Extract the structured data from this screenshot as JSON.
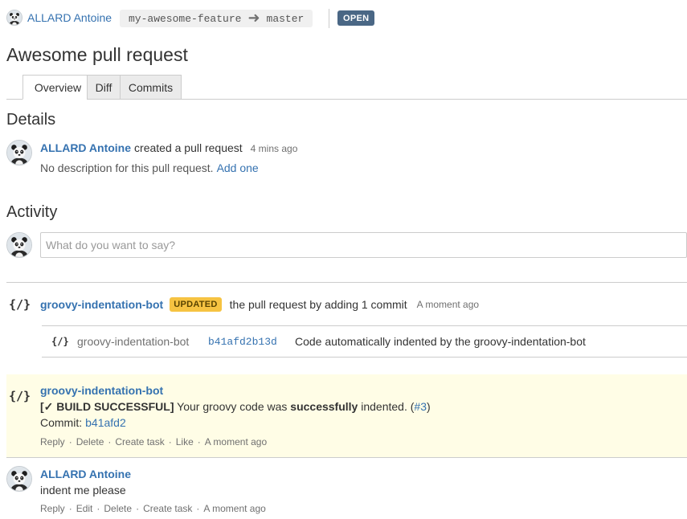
{
  "header": {
    "author": "ALLARD Antoine",
    "source_branch": "my-awesome-feature",
    "target_branch": "master",
    "state": "OPEN"
  },
  "title": "Awesome pull request",
  "tabs": [
    {
      "label": "Overview",
      "active": true
    },
    {
      "label": "Diff",
      "active": false
    },
    {
      "label": "Commits",
      "active": false
    }
  ],
  "details": {
    "heading": "Details",
    "author": "ALLARD Antoine",
    "action": "created a pull request",
    "time": "4 mins ago",
    "description": "No description for this pull request.",
    "add_link": "Add one"
  },
  "activity": {
    "heading": "Activity",
    "comment_placeholder": "What do you want to say?",
    "update_event": {
      "icon": "{/}",
      "author": "groovy-indentation-bot",
      "badge": "UPDATED",
      "text": "the pull request by adding 1 commit",
      "time": "A moment ago",
      "commit": {
        "icon": "{/}",
        "author": "groovy-indentation-bot",
        "hash": "b41afd2b13d",
        "message": "Code automatically indented by the groovy-indentation-bot"
      }
    },
    "bot_comment": {
      "icon": "{/}",
      "author": "groovy-indentation-bot",
      "status": "[✓ BUILD SUCCESSFUL]",
      "text_before": "Your groovy code was",
      "text_bold": "successfully",
      "text_after": "indented. (",
      "link": "#3",
      "text_end": ")",
      "commit_label": "Commit:",
      "commit_hash": "b41afd2",
      "actions": [
        "Reply",
        "Delete",
        "Create task",
        "Like"
      ],
      "time": "A moment ago"
    },
    "user_comment": {
      "author": "ALLARD Antoine",
      "text": "indent me please",
      "actions": [
        "Reply",
        "Edit",
        "Delete",
        "Create task"
      ],
      "time": "A moment ago"
    }
  },
  "colors": {
    "link": "#3572b0",
    "open_badge": "#4a6785",
    "updated_badge": "#f6c342",
    "bot_comment_bg": "#fffde6"
  }
}
